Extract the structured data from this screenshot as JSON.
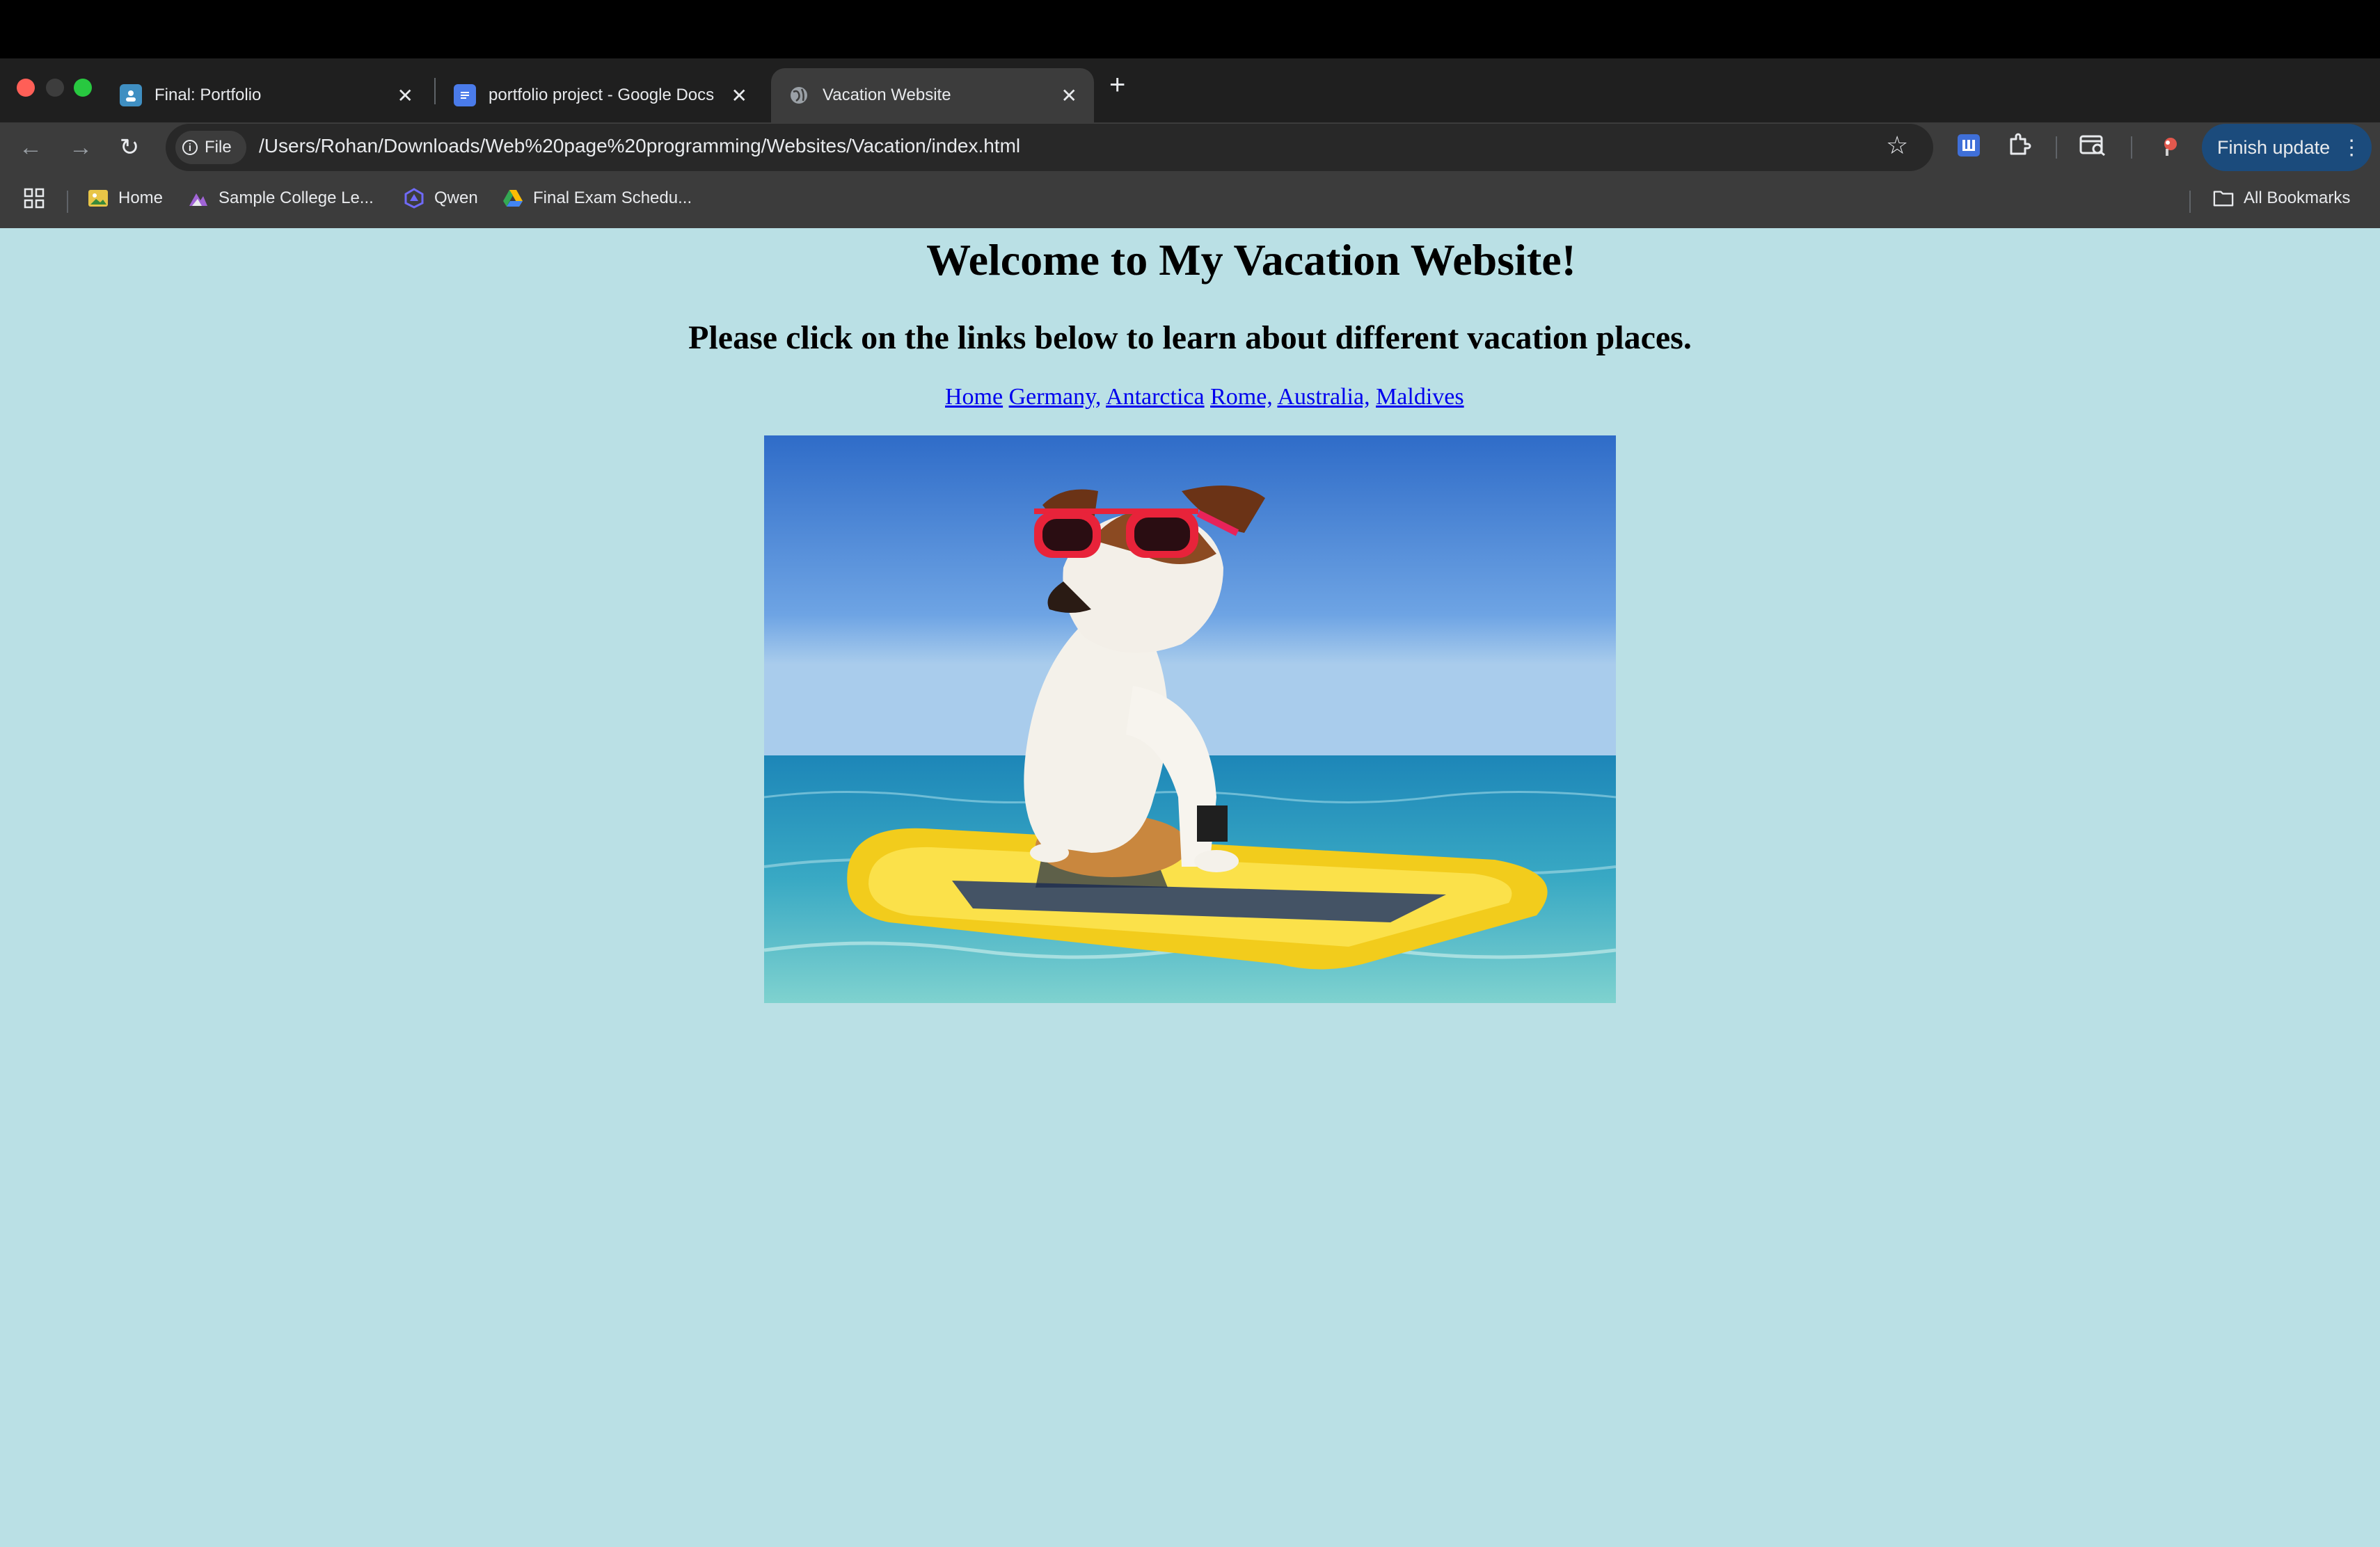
{
  "browser": {
    "tabs": [
      {
        "title": "Final: Portfolio",
        "close": "✕",
        "active": false
      },
      {
        "title": "portfolio project - Google Docs",
        "close": "✕",
        "active": false
      },
      {
        "title": "Vacation Website",
        "close": "✕",
        "active": true
      }
    ],
    "new_tab": "+",
    "nav": {
      "back": "←",
      "forward": "→",
      "reload": "↻"
    },
    "address": {
      "chip_label": "File",
      "chip_icon": "i",
      "url": "/Users/Rohan/Downloads/Web%20page%20programming/Websites/Vacation/index.html"
    },
    "icons": {
      "star": "☆"
    },
    "update_button": {
      "label": "Finish update",
      "menu": "⋮"
    },
    "bookmarks": [
      {
        "label": "Home"
      },
      {
        "label": "Sample College Le..."
      },
      {
        "label": "Qwen"
      },
      {
        "label": "Final Exam Schedu..."
      }
    ],
    "all_bookmarks": "All Bookmarks"
  },
  "page": {
    "heading": "Welcome to My Vacation Website!",
    "subheading": "Please click on the links below to learn about different vacation places.",
    "nav_links": [
      {
        "label": "Home",
        "after": " "
      },
      {
        "label": "Germany,",
        "after": " "
      },
      {
        "label": "Antarctica",
        "after": " "
      },
      {
        "label": "Rome,",
        "after": " "
      },
      {
        "label": "Australia,",
        "after": " "
      },
      {
        "label": "Maldives",
        "after": ""
      }
    ]
  },
  "colors": {
    "page_background": "#bae0e5",
    "link": "#0000ee",
    "update_button": "#1b4b7c"
  }
}
